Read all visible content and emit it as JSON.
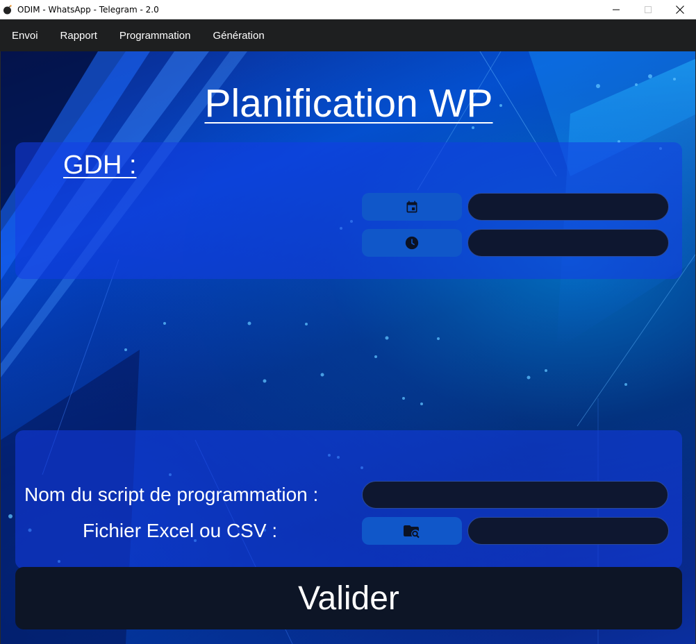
{
  "window": {
    "title": "ODIM - WhatsApp - Telegram - 2.0",
    "app_icon": "bomb-icon"
  },
  "menu": {
    "items": [
      {
        "label": "Envoi"
      },
      {
        "label": "Rapport"
      },
      {
        "label": "Programmation"
      },
      {
        "label": "Génération"
      }
    ]
  },
  "page": {
    "title": "Planification WP"
  },
  "gdh": {
    "label": "GDH :",
    "date_button_icon": "calendar-icon",
    "time_button_icon": "clock-icon",
    "date_value": "",
    "time_value": ""
  },
  "script": {
    "name_label": "Nom du script de programmation :",
    "name_value": "",
    "file_label": "Fichier Excel ou CSV :",
    "file_button_icon": "folder-search-icon",
    "file_value": ""
  },
  "actions": {
    "submit_label": "Valider"
  },
  "colors": {
    "menubar": "#1e1f20",
    "panel": "#1440e6",
    "button": "#1057c9",
    "field": "#0e1730",
    "submit": "#0d1526"
  }
}
